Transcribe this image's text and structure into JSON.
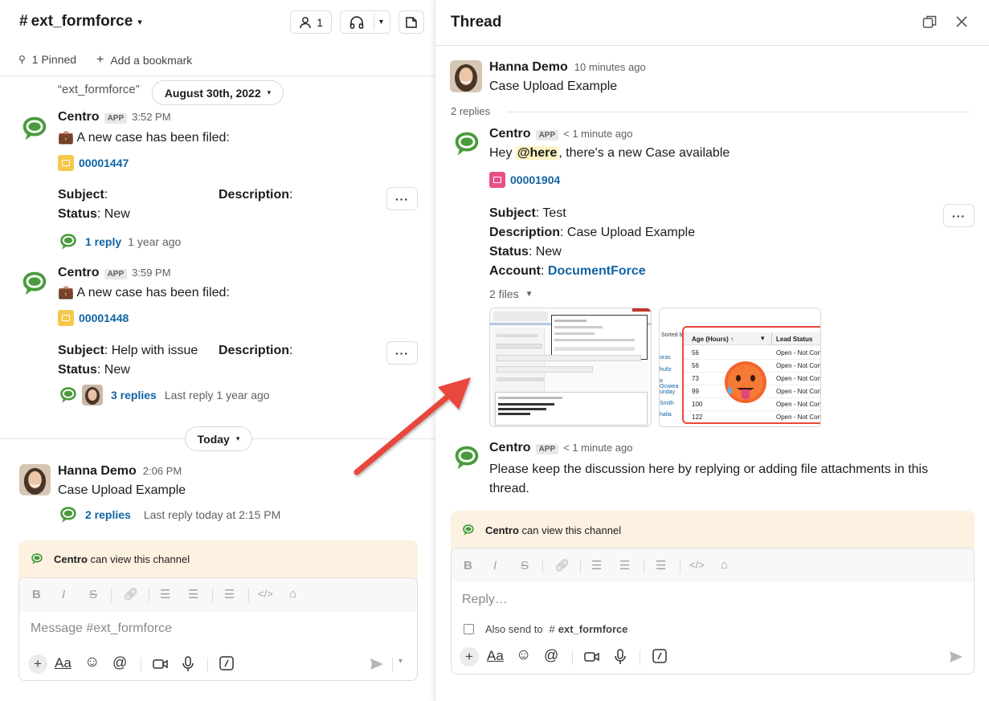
{
  "channel": {
    "name": "ext_formforce",
    "member_count": "1",
    "pinned": "1 Pinned",
    "add_bookmark": "Add a bookmark",
    "channel_quote": "“ext_formforce”",
    "date_pill": "August 30th, 2022",
    "today_pill": "Today",
    "messages": [
      {
        "author": "Centro",
        "badge": "APP",
        "time": "3:52 PM",
        "text": "💼 A new case has been filed:",
        "case_number": "00001447",
        "subject_label": "Subject",
        "subject_value": "",
        "description_label": "Description",
        "status_label": "Status",
        "status_value": "New",
        "replies": "1 reply",
        "reply_time": "1 year ago"
      },
      {
        "author": "Centro",
        "badge": "APP",
        "time": "3:59 PM",
        "text": "💼 A new case has been filed:",
        "case_number": "00001448",
        "subject_label": "Subject",
        "subject_value": "Help with issue",
        "description_label": "Description",
        "status_label": "Status",
        "status_value": "New",
        "replies": "3 replies",
        "reply_time": "Last reply 1 year ago"
      },
      {
        "author": "Hanna Demo",
        "time": "2:06 PM",
        "text": "Case Upload Example",
        "replies": "2 replies",
        "reply_time": "Last reply today at 2:15 PM"
      }
    ],
    "notice_author": "Centro",
    "notice_text": "can view this channel",
    "composer_placeholder": "Message #ext_formforce"
  },
  "thread": {
    "title": "Thread",
    "parent_author": "Hanna Demo",
    "parent_time": "10 minutes ago",
    "parent_text": "Case Upload Example",
    "reply_count": "2 replies",
    "reply1": {
      "author": "Centro",
      "badge": "APP",
      "time": "< 1 minute ago",
      "text_pre": "Hey",
      "mention": "@here",
      "text_post": ", there's a new Case available",
      "case_number": "00001904",
      "subject_label": "Subject",
      "subject_value": "Test",
      "description_label": "Description",
      "description_value": "Case Upload Example",
      "status_label": "Status",
      "status_value": "New",
      "account_label": "Account",
      "account_value": "DocumentForce",
      "files_label": "2 files"
    },
    "reply2": {
      "author": "Centro",
      "badge": "APP",
      "time": "< 1 minute ago",
      "text": "Please keep the discussion here by replying or adding file attachments in this thread."
    },
    "notice_author": "Centro",
    "notice_text": "can view this channel",
    "reply_placeholder": "Reply…",
    "also_send_label": "Also send to",
    "also_send_channel": "ext_formforce",
    "file2_table": {
      "col1": "Age (Hours) ↑",
      "col2": "Lead Status",
      "sorted_by": "Sorted by",
      "rows": [
        {
          "age": "56",
          "status": "Open - Not Conta"
        },
        {
          "age": "56",
          "status": "Open - Not Conta"
        },
        {
          "age": "73",
          "status": "Open - Not Conta"
        },
        {
          "age": "99",
          "status": "Open - Not Conta"
        },
        {
          "age": "100",
          "status": "Open - Not Conta"
        },
        {
          "age": "122",
          "status": "Open - Not Conta"
        }
      ],
      "left_names": [
        "oras",
        "hultz",
        "a Ocwiea",
        "unday",
        "Smith",
        "halia"
      ]
    }
  },
  "colors": {
    "link": "#1264a3",
    "notice_bg": "#fdf1e1",
    "arrow": "#e8473b",
    "case_yellow": "#f5c84c",
    "case_pink": "#e8508a",
    "mention_bg": "#fff4c2",
    "centro_green": "#4a9b3c"
  }
}
